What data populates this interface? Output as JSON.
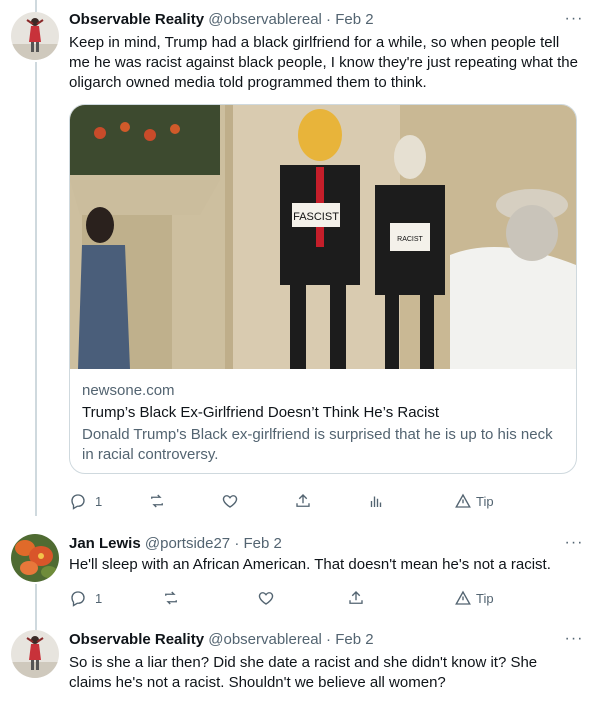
{
  "tweets": [
    {
      "name": "Observable Reality",
      "handle": "@observablereal",
      "separator": "·",
      "date": "Feb 2",
      "more": "···",
      "text": "Keep in mind, Trump had a black girlfriend for a while, so when people tell me he was racist against black people, I know they're just repeating what the oligarch owned media told programmed them to think.",
      "card": {
        "domain": "newsone.com",
        "title": "Trump’s Black Ex-Girlfriend Doesn’t Think He’s Racist",
        "description": "Donald Trump's Black ex-girlfriend is surprised that he is up to his neck in racial controversy.",
        "sign1": "FASCIST",
        "sign2": "RACIST"
      },
      "actions": {
        "reply_count": "1",
        "tip": "Tip"
      }
    },
    {
      "name": "Jan Lewis",
      "handle": "@portside27",
      "separator": "·",
      "date": "Feb 2",
      "more": "···",
      "text": "He'll sleep with an African American.  That doesn't mean he's not a racist.",
      "actions": {
        "reply_count": "1",
        "tip": "Tip"
      }
    },
    {
      "name": "Observable Reality",
      "handle": "@observablereal",
      "separator": "·",
      "date": "Feb 2",
      "more": "···",
      "text": "So is she a liar then? Did she date a racist and she didn't know it? She claims he's not a racist. Shouldn't we believe all women?"
    }
  ],
  "colors": {
    "text_primary": "#0f1419",
    "text_secondary": "#536471",
    "border": "#cfd9de",
    "thread_line": "#cfd9de"
  },
  "icons": [
    "reply-icon",
    "retweet-icon",
    "like-icon",
    "share-icon",
    "analytics-icon",
    "tip-icon",
    "more-icon"
  ]
}
